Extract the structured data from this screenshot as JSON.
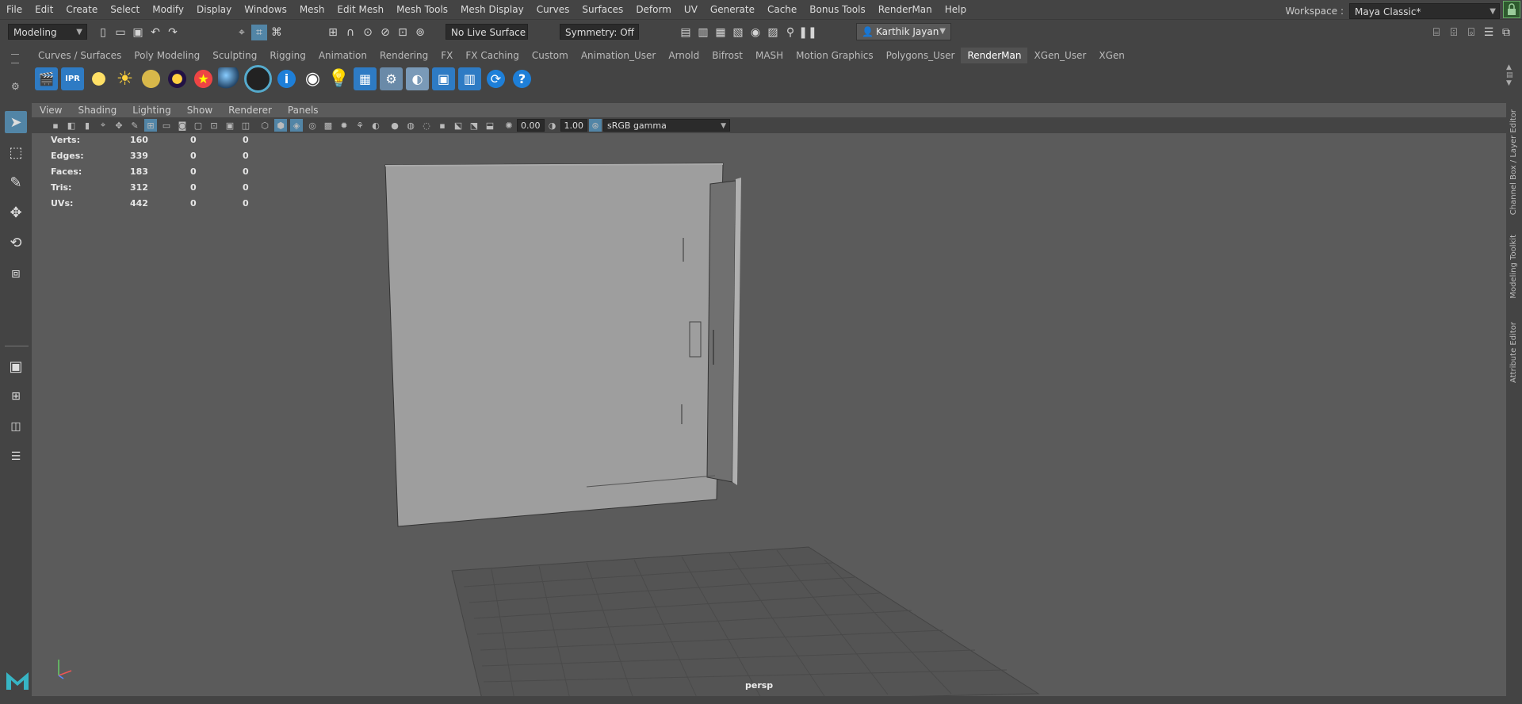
{
  "menubar": {
    "items": [
      "File",
      "Edit",
      "Create",
      "Select",
      "Modify",
      "Display",
      "Windows",
      "Mesh",
      "Edit Mesh",
      "Mesh Tools",
      "Mesh Display",
      "Curves",
      "Surfaces",
      "Deform",
      "UV",
      "Generate",
      "Cache",
      "Bonus Tools",
      "RenderMan",
      "Help"
    ],
    "workspace_label": "Workspace :",
    "workspace_value": "Maya Classic*"
  },
  "statusline": {
    "mode": "Modeling",
    "live_surface": "No Live Surface",
    "symmetry": "Symmetry: Off",
    "user": "Karthik Jayan"
  },
  "shelf": {
    "tabs": [
      "Curves / Surfaces",
      "Poly Modeling",
      "Sculpting",
      "Rigging",
      "Animation",
      "Rendering",
      "FX",
      "FX Caching",
      "Custom",
      "Animation_User",
      "Arnold",
      "Bifrost",
      "MASH",
      "Motion Graphics",
      "Polygons_User",
      "RenderMan",
      "XGen_User",
      "XGen"
    ],
    "active_tab": "RenderMan",
    "icon_names": [
      "render-clapper-icon",
      "ipr-icon",
      "light-sphere-icon",
      "sun-light-icon",
      "dome-light-icon",
      "mesh-light-icon",
      "star-icon",
      "shaded-sphere-icon",
      "ring-icon",
      "info-icon",
      "eye-icon",
      "bulb-icon",
      "calculator-icon",
      "photo-icon",
      "moon-icon",
      "image-icon",
      "chart-icon",
      "refresh-icon",
      "help-icon"
    ]
  },
  "panel": {
    "menus": [
      "View",
      "Shading",
      "Lighting",
      "Show",
      "Renderer",
      "Panels"
    ],
    "exposure": "0.00",
    "gamma": "1.00",
    "color_space": "sRGB gamma",
    "camera": "persp"
  },
  "hud": {
    "rows": [
      {
        "label": "Verts:",
        "a": "160",
        "b": "0",
        "c": "0"
      },
      {
        "label": "Edges:",
        "a": "339",
        "b": "0",
        "c": "0"
      },
      {
        "label": "Faces:",
        "a": "183",
        "b": "0",
        "c": "0"
      },
      {
        "label": "Tris:",
        "a": "312",
        "b": "0",
        "c": "0"
      },
      {
        "label": "UVs:",
        "a": "442",
        "b": "0",
        "c": "0"
      }
    ]
  },
  "right_tabs": [
    "Channel Box / Layer Editor",
    "Modeling Toolkit",
    "Attribute Editor"
  ],
  "colors": {
    "accent": "#5285a6",
    "viewport_bg": "#5b5b5b",
    "ui_bg": "#444444"
  }
}
